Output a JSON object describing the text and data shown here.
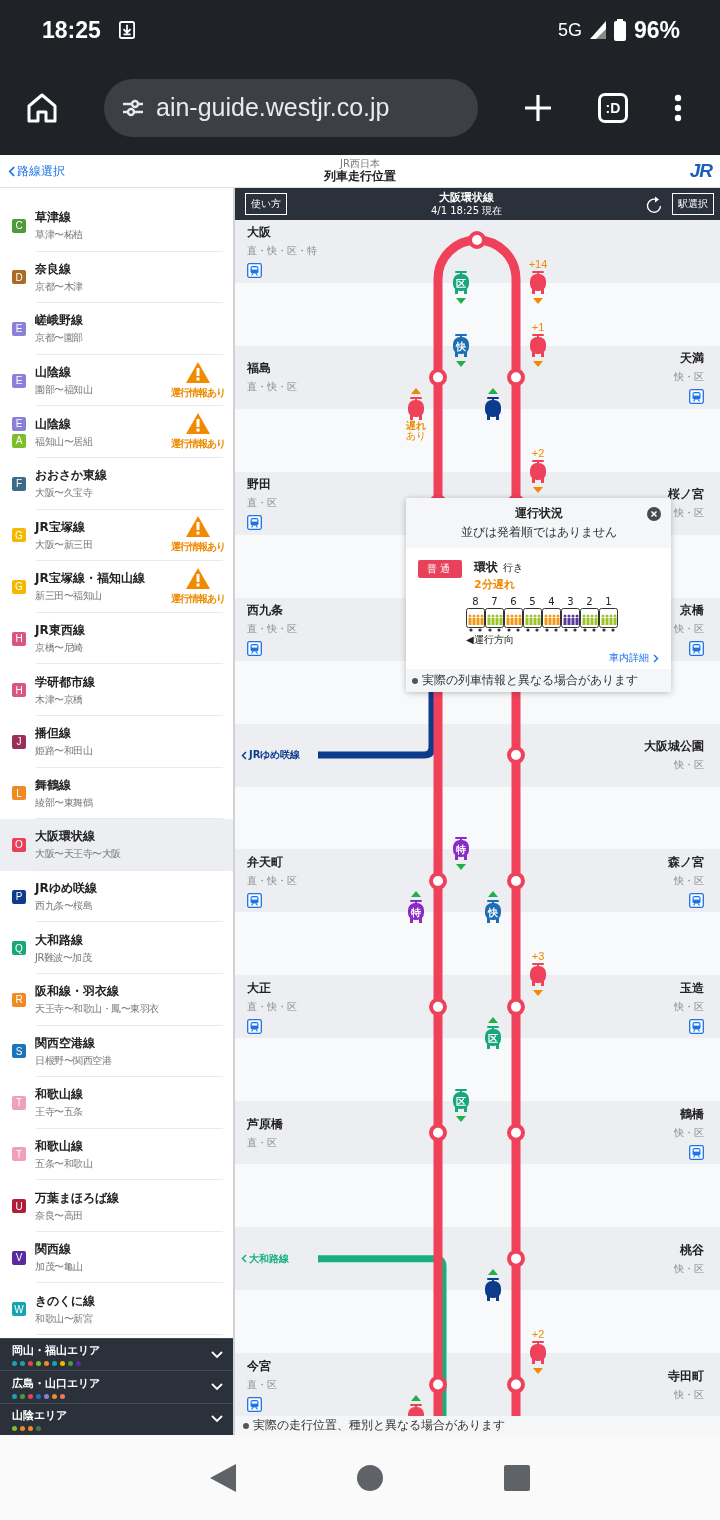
{
  "status_bar": {
    "time": "18:25",
    "network": "5G",
    "battery": "96%"
  },
  "browser": {
    "url": "ain-guide.westjr.co.jp",
    "tab_badge": ":D"
  },
  "header": {
    "back_link": "路線選択",
    "brand": "JR西日本",
    "title": "列車走行位置",
    "logo": "JR"
  },
  "sidebar": {
    "lines": [
      {
        "codes": [
          {
            "letter": "C",
            "color": "#4f9a3a"
          }
        ],
        "name": "草津線",
        "range": "草津〜柘植",
        "selected": false
      },
      {
        "codes": [
          {
            "letter": "D",
            "color": "#a86c25"
          }
        ],
        "name": "奈良線",
        "range": "京都〜木津",
        "selected": false
      },
      {
        "codes": [
          {
            "letter": "E",
            "color": "#8a80d8"
          }
        ],
        "name": "嵯峨野線",
        "range": "京都〜園部",
        "selected": false
      },
      {
        "codes": [
          {
            "letter": "E",
            "color": "#8a80d8"
          }
        ],
        "name": "山陰線",
        "range": "園部〜福知山",
        "alert": "運行情報あり",
        "selected": false
      },
      {
        "codes": [
          {
            "letter": "E",
            "color": "#8a80d8"
          },
          {
            "letter": "A",
            "color": "#7dbf2a"
          }
        ],
        "name": "山陰線",
        "range": "福知山〜居組",
        "alert": "運行情報あり",
        "selected": false
      },
      {
        "codes": [
          {
            "letter": "F",
            "color": "#3d6b8a"
          }
        ],
        "name": "おおさか東線",
        "range": "大阪〜久宝寺",
        "selected": false
      },
      {
        "codes": [
          {
            "letter": "G",
            "color": "#f4b800"
          }
        ],
        "name": "JR宝塚線",
        "range": "大阪〜新三田",
        "alert": "運行情報あり",
        "selected": false
      },
      {
        "codes": [
          {
            "letter": "G",
            "color": "#f4b800"
          }
        ],
        "name": "JR宝塚線・福知山線",
        "range": "新三田〜福知山",
        "alert": "運行情報あり",
        "selected": false
      },
      {
        "codes": [
          {
            "letter": "H",
            "color": "#d9577e"
          }
        ],
        "name": "JR東西線",
        "range": "京橋〜尼崎",
        "selected": false
      },
      {
        "codes": [
          {
            "letter": "H",
            "color": "#d9577e"
          }
        ],
        "name": "学研都市線",
        "range": "木津〜京橋",
        "selected": false
      },
      {
        "codes": [
          {
            "letter": "J",
            "color": "#9c2f57"
          }
        ],
        "name": "播但線",
        "range": "姫路〜和田山",
        "selected": false
      },
      {
        "codes": [
          {
            "letter": "L",
            "color": "#f08a24"
          }
        ],
        "name": "舞鶴線",
        "range": "綾部〜東舞鶴",
        "selected": false
      },
      {
        "codes": [
          {
            "letter": "O",
            "color": "#e8415a"
          }
        ],
        "name": "大阪環状線",
        "range": "大阪〜天王寺〜大阪",
        "selected": true
      },
      {
        "codes": [
          {
            "letter": "P",
            "color": "#123a8c"
          }
        ],
        "name": "JRゆめ咲線",
        "range": "西九条〜桜島",
        "selected": false
      },
      {
        "codes": [
          {
            "letter": "Q",
            "color": "#1aa57a"
          }
        ],
        "name": "大和路線",
        "range": "JR難波〜加茂",
        "selected": false
      },
      {
        "codes": [
          {
            "letter": "R",
            "color": "#f08a24"
          }
        ],
        "name": "阪和線・羽衣線",
        "range": "天王寺〜和歌山・鳳〜東羽衣",
        "selected": false
      },
      {
        "codes": [
          {
            "letter": "S",
            "color": "#1c75bc"
          }
        ],
        "name": "関西空港線",
        "range": "日根野〜関西空港",
        "selected": false
      },
      {
        "codes": [
          {
            "letter": "T",
            "color": "#f0a0bc"
          }
        ],
        "name": "和歌山線",
        "range": "王寺〜五条",
        "selected": false
      },
      {
        "codes": [
          {
            "letter": "T",
            "color": "#f0a0bc"
          }
        ],
        "name": "和歌山線",
        "range": "五条〜和歌山",
        "selected": false
      },
      {
        "codes": [
          {
            "letter": "U",
            "color": "#b01f3a"
          }
        ],
        "name": "万葉まほろば線",
        "range": "奈良〜高田",
        "selected": false
      },
      {
        "codes": [
          {
            "letter": "V",
            "color": "#5b2aa0"
          }
        ],
        "name": "関西線",
        "range": "加茂〜亀山",
        "selected": false
      },
      {
        "codes": [
          {
            "letter": "W",
            "color": "#16a4b0"
          }
        ],
        "name": "きのくに線",
        "range": "和歌山〜新宮",
        "selected": false
      }
    ],
    "areas": [
      {
        "name": "岡山・福山エリア",
        "dots": [
          {
            "color": "#16a4b0"
          },
          {
            "color": "#16a4b0"
          },
          {
            "color": "#e8415a"
          },
          {
            "color": "#7dbf2a"
          },
          {
            "color": "#f08a24"
          },
          {
            "color": "#16a4b0"
          },
          {
            "color": "#f4b800"
          },
          {
            "color": "#4f9a3a"
          },
          {
            "color": "#5b2aa0"
          }
        ]
      },
      {
        "name": "広島・山口エリア",
        "dots": [
          {
            "color": "#16a4b0"
          },
          {
            "color": "#4f9a3a"
          },
          {
            "color": "#e8415a"
          },
          {
            "color": "#1c75bc"
          },
          {
            "color": "#8a80d8"
          },
          {
            "color": "#f08a24"
          },
          {
            "color": "#f07860"
          }
        ]
      },
      {
        "name": "山陰エリア",
        "dots": [
          {
            "color": "#7dbf2a"
          },
          {
            "color": "#f08a24"
          },
          {
            "color": "#f08a24"
          },
          {
            "color": "#3d7a4a"
          }
        ]
      }
    ]
  },
  "toolbar": {
    "help_button": "使い方",
    "line_name": "大阪環状線",
    "date": "4/1 18:25",
    "date_suffix": "現在",
    "station_button": "駅選択"
  },
  "diagram": {
    "bands": [
      {
        "kind": "station",
        "left": {
          "name": "大阪",
          "services": "直・快・区・特",
          "info": true
        }
      },
      {
        "kind": "gap",
        "inner_left": [
          {
            "label": "区",
            "color": "#17a77a",
            "at_bottom": false
          }
        ],
        "outer_right": [
          {
            "color": "#f0415b",
            "delay": "+14",
            "at_bottom": false
          }
        ]
      },
      {
        "kind": "station",
        "left": {
          "name": "福島",
          "services": "直・快・区",
          "info": false
        },
        "right": {
          "name": "天満",
          "services": "快・区",
          "info": true
        },
        "inner_left": [
          {
            "label": "快",
            "color": "#1b6db5",
            "at_bottom": false
          }
        ],
        "outer_right": [
          {
            "color": "#f0415b",
            "delay": "+1",
            "at_bottom": false
          }
        ]
      },
      {
        "kind": "gap",
        "outer_left": [
          {
            "color": "#f0415b",
            "note": [
              "遅れ",
              "あり"
            ],
            "at_bottom": false
          }
        ],
        "inner_right": [
          {
            "color": "#0d3b8c",
            "at_bottom": false
          }
        ]
      },
      {
        "kind": "station",
        "left": {
          "name": "野田",
          "services": "直・区",
          "info": true
        },
        "right": {
          "name": "桜ノ宮",
          "services": "快・区",
          "info": false
        },
        "outer_right": [
          {
            "color": "#f0415b",
            "delay": "+2",
            "at_bottom": false
          }
        ]
      },
      {
        "kind": "gap"
      },
      {
        "kind": "station",
        "left": {
          "name": "西九条",
          "services": "直・快・区",
          "info": true
        },
        "right": {
          "name": "京橋",
          "services": "快・区",
          "info": true
        }
      },
      {
        "kind": "gap"
      },
      {
        "kind": "station",
        "right": {
          "name": "大阪城公園",
          "services": "快・区",
          "info": false
        },
        "branch": {
          "name": "JRゆめ咲線",
          "color": "#0d3b8c",
          "runs_down": false
        }
      },
      {
        "kind": "gap"
      },
      {
        "kind": "station",
        "left": {
          "name": "弁天町",
          "services": "直・快・区",
          "info": true
        },
        "right": {
          "name": "森ノ宮",
          "services": "快・区",
          "info": true
        },
        "inner_left": [
          {
            "label": "特",
            "color": "#8a2bc8",
            "at_bottom": false
          }
        ]
      },
      {
        "kind": "gap",
        "outer_left": [
          {
            "label": "特",
            "color": "#8a2bc8",
            "at_bottom": false
          }
        ],
        "inner_right": [
          {
            "label": "快",
            "color": "#1b6db5",
            "at_bottom": false
          }
        ]
      },
      {
        "kind": "station",
        "left": {
          "name": "大正",
          "services": "直・快・区",
          "info": true
        },
        "right": {
          "name": "玉造",
          "services": "快・区",
          "info": true
        },
        "outer_right": [
          {
            "color": "#f0415b",
            "delay": "+3",
            "at_bottom": false
          }
        ]
      },
      {
        "kind": "gap",
        "inner_right": [
          {
            "label": "区",
            "color": "#17a77a",
            "at_bottom": false
          }
        ]
      },
      {
        "kind": "station",
        "left": {
          "name": "芦原橋",
          "services": "直・区",
          "info": false
        },
        "right": {
          "name": "鶴橋",
          "services": "快・区",
          "info": true
        },
        "inner_left": [
          {
            "label": "区",
            "color": "#17a77a",
            "at_bottom": false
          }
        ]
      },
      {
        "kind": "gap"
      },
      {
        "kind": "station",
        "right": {
          "name": "桃谷",
          "services": "快・区",
          "info": false
        },
        "branch": {
          "name": "大和路線",
          "color": "#17b07c",
          "runs_down": true
        }
      },
      {
        "kind": "gap",
        "inner_right": [
          {
            "color": "#0d3b8c",
            "at_bottom": false
          }
        ]
      },
      {
        "kind": "station",
        "left": {
          "name": "今宮",
          "services": "直・区",
          "info": true
        },
        "right": {
          "name": "寺田町",
          "services": "快・区",
          "info": false
        },
        "outer_right": [
          {
            "color": "#f0415b",
            "delay": "+2",
            "at_bottom": false
          }
        ],
        "outer_left": [
          {
            "color": "#f0415b",
            "at_bottom": true
          }
        ]
      }
    ],
    "footnote": "実際の走行位置、種別と異なる場合があります"
  },
  "popup": {
    "title": "運行状況",
    "subtitle": "並びは発着順ではありません",
    "type_badge": "普通",
    "destination": "環状",
    "destination_suffix": "行き",
    "delay": "2分遅れ",
    "cars": [
      {
        "number": "8",
        "color": "#f09a1a"
      },
      {
        "number": "7",
        "color": "#9cc32a"
      },
      {
        "number": "6",
        "color": "#f09a1a"
      },
      {
        "number": "5",
        "color": "#9cc32a"
      },
      {
        "number": "4",
        "color": "#f09a1a"
      },
      {
        "number": "3",
        "color": "#5b3a9c"
      },
      {
        "number": "2",
        "color": "#9cc32a"
      },
      {
        "number": "1",
        "color": "#9cc32a"
      }
    ],
    "direction_label": "◀運行方向",
    "detail_link": "車内詳細",
    "footnote": "実際の列車情報と異なる場合があります"
  }
}
